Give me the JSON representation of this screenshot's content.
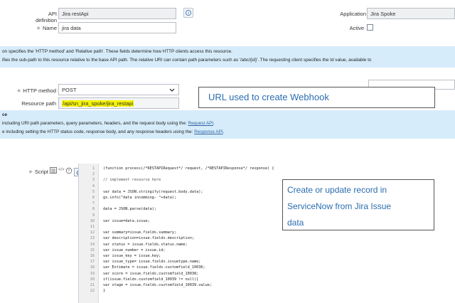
{
  "form": {
    "api_definition_label": "API definition",
    "api_definition_value": "Jira restApi",
    "name_label": "Name",
    "name_value": "jira data",
    "application_label": "Application",
    "application_value": "Jira Spoke",
    "active_label": "Active",
    "http_method_label": "HTTP method",
    "http_method_value": "POST",
    "resource_path_label": "Resource path",
    "resource_path_value": "/api/sn_jira_spoke/jira_restapi",
    "script_label": "Script"
  },
  "info1": {
    "line1": "on specifies the 'HTTP method' and 'Relative path'. These fields determine how HTTP clients access this resource.",
    "line2": "ifies the sub-path to this resource relative to the base API path. The relative URI can contain path parameters such as '/abc/{id}'. The requesting client specifies the Id value, available to"
  },
  "info2": {
    "title": "ce",
    "line1_prefix": "including URI path parameters, query parameters, headers, and the request body using the: ",
    "line1_link": "Request API",
    "line1_suffix": ".",
    "line2_prefix": "e including setting the HTTP status code, response body, and any response headers using the: ",
    "line2_link": "Response API",
    "line2_suffix": "."
  },
  "callouts": {
    "webhook": "URL used to create Webhook",
    "record_line1": "Create or update record in",
    "record_line2": "ServiceNow from Jira Issue",
    "record_line3": "data"
  },
  "code": [
    {
      "n": "1",
      "t": "(function process(/*RESTAPIRequest*/ request, /*RESTAPIResponse*/ response) {"
    },
    {
      "n": "2",
      "t": ""
    },
    {
      "n": "3",
      "t": "    // implement resource here"
    },
    {
      "n": "4",
      "t": ""
    },
    {
      "n": "5",
      "t": "    var data = JSON.stringify(request.body.data);"
    },
    {
      "n": "6",
      "t": "    gs.info(\"data incomming- \"+data);"
    },
    {
      "n": "7",
      "t": ""
    },
    {
      "n": "8",
      "t": "    data = JSON.parse(data);"
    },
    {
      "n": "9",
      "t": ""
    },
    {
      "n": "10",
      "t": "    var issue=data.issue;"
    },
    {
      "n": "11",
      "t": ""
    },
    {
      "n": "12",
      "t": "    var summary=issue.fields.summary;"
    },
    {
      "n": "13",
      "t": "    var description=issue.fields.description;"
    },
    {
      "n": "14",
      "t": "    var status = issue.fields.status.name;"
    },
    {
      "n": "15",
      "t": "    var issue_number = issue.id;"
    },
    {
      "n": "16",
      "t": "    var issue_key = issue.key;"
    },
    {
      "n": "17",
      "t": "    var issue_type= issue.fields.issuetype.name;"
    },
    {
      "n": "18",
      "t": "    var Estimate = issue.fields.customfield_10036;"
    },
    {
      "n": "19",
      "t": "    var score = issue.fields.customfield_10038;"
    },
    {
      "n": "20",
      "t": "    if(issue.fields.customfield_10039 != null){"
    },
    {
      "n": "21",
      "t": "    var stage = issue.fields.customfield_10039.value;"
    },
    {
      "n": "22",
      "t": "    }"
    }
  ]
}
